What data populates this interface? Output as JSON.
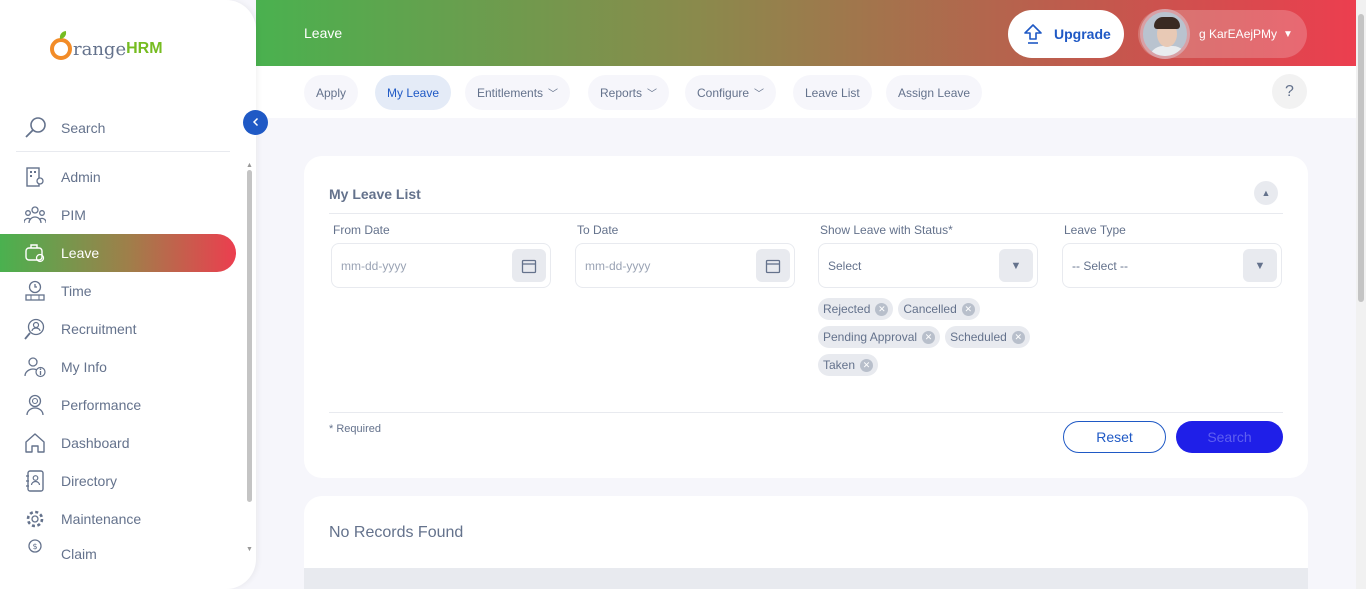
{
  "brand": {
    "logo_text_1": "range",
    "logo_text_2": "HRM"
  },
  "sidebar": {
    "search_label": "Search",
    "items": [
      {
        "label": "Admin",
        "icon": "admin-icon"
      },
      {
        "label": "PIM",
        "icon": "pim-icon"
      },
      {
        "label": "Leave",
        "icon": "leave-icon",
        "active": true
      },
      {
        "label": "Time",
        "icon": "time-icon"
      },
      {
        "label": "Recruitment",
        "icon": "recruitment-icon"
      },
      {
        "label": "My Info",
        "icon": "my-info-icon"
      },
      {
        "label": "Performance",
        "icon": "performance-icon"
      },
      {
        "label": "Dashboard",
        "icon": "dashboard-icon"
      },
      {
        "label": "Directory",
        "icon": "directory-icon"
      },
      {
        "label": "Maintenance",
        "icon": "maintenance-icon"
      },
      {
        "label": "Claim",
        "icon": "claim-icon"
      }
    ]
  },
  "header": {
    "title": "Leave",
    "upgrade_label": "Upgrade",
    "user_name": "g KarEAejPMy"
  },
  "topnav": {
    "tabs": [
      {
        "label": "Apply"
      },
      {
        "label": "My Leave",
        "active": true
      },
      {
        "label": "Entitlements",
        "dropdown": true
      },
      {
        "label": "Reports",
        "dropdown": true
      },
      {
        "label": "Configure",
        "dropdown": true
      },
      {
        "label": "Leave List"
      },
      {
        "label": "Assign Leave"
      }
    ],
    "help_label": "?"
  },
  "filter": {
    "title": "My Leave List",
    "from_date": {
      "label": "From Date",
      "placeholder": "mm-dd-yyyy"
    },
    "to_date": {
      "label": "To Date",
      "placeholder": "mm-dd-yyyy"
    },
    "status": {
      "label": "Show Leave with Status*",
      "value": "Select"
    },
    "leave_type": {
      "label": "Leave Type",
      "value": "-- Select --"
    },
    "status_chips": [
      "Rejected",
      "Cancelled",
      "Pending Approval",
      "Scheduled",
      "Taken"
    ],
    "required_note": "* Required",
    "reset_label": "Reset",
    "search_label": "Search"
  },
  "records": {
    "empty_text": "No Records Found"
  },
  "colors": {
    "accent": "#1f59c5",
    "brand_orange": "#f28c28",
    "brand_green": "#76bc21",
    "header_start": "#4ab14f",
    "header_end": "#ec3e4f"
  }
}
